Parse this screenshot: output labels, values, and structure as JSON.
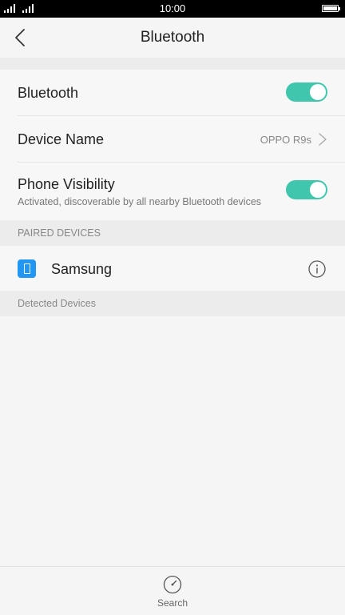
{
  "status_bar": {
    "time": "10:00"
  },
  "header": {
    "title": "Bluetooth"
  },
  "settings": {
    "bluetooth": {
      "label": "Bluetooth",
      "enabled": true
    },
    "device_name": {
      "label": "Device Name",
      "value": "OPPO R9s"
    },
    "phone_visibility": {
      "label": "Phone Visibility",
      "subtitle": "Activated, discoverable by all nearby Bluetooth devices",
      "enabled": true
    }
  },
  "paired_devices": {
    "header": "PAIRED DEVICES",
    "items": [
      {
        "name": "Samsung",
        "icon": "phone-icon"
      }
    ]
  },
  "detected_devices": {
    "header": "Detected Devices"
  },
  "bottom_bar": {
    "search_label": "Search"
  },
  "colors": {
    "accent": "#3fc6ad",
    "device_icon": "#2196f3"
  }
}
